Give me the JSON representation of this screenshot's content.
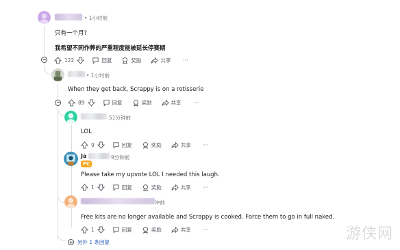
{
  "comments": [
    {
      "time": "• 1小时前",
      "lines": [
        "只有一个月?",
        "我希望不同作弊的严重程度能被延长停赛期"
      ],
      "votes": "122"
    },
    {
      "time": "• 1小时前",
      "text": "When they get back, Scrappy is on a rotisserie",
      "votes": "89"
    },
    {
      "time": "51分钟前",
      "text": "LOL",
      "votes": "9"
    },
    {
      "name_partial": "Ja",
      "time": "9分钟前",
      "badge": "PC",
      "text": "Please take my upvote LOL I needed this laugh.",
      "votes": "1"
    },
    {
      "time": "冲前",
      "text": "Free kits are no longer available and Scrappy is cooked. Force them to go in full naked.",
      "votes": "1"
    }
  ],
  "actions": {
    "reply": "回复",
    "award": "奖励",
    "share": "共享",
    "more": "···"
  },
  "more_replies": "另外 1 条回复",
  "watermark": "游侠网",
  "colors": {
    "link": "#2e5fb8",
    "meta": "#7c7c83",
    "badge": "#f5a623"
  }
}
